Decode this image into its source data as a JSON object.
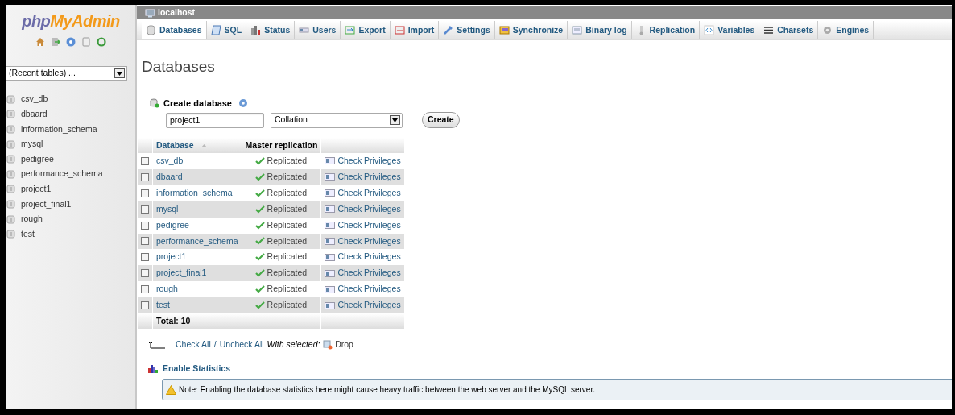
{
  "logo": {
    "part_1": "php",
    "part_2": "MyAdmin"
  },
  "recent_tables": {
    "value": "(Recent tables) ..."
  },
  "sidebar": {
    "items": [
      {
        "label": "csv_db"
      },
      {
        "label": "dbaard"
      },
      {
        "label": "information_schema"
      },
      {
        "label": "mysql"
      },
      {
        "label": "pedigree"
      },
      {
        "label": "performance_schema"
      },
      {
        "label": "project1"
      },
      {
        "label": "project_final1"
      },
      {
        "label": "rough"
      },
      {
        "label": "test"
      }
    ]
  },
  "breadcrumb": "localhost",
  "tabs": [
    {
      "label": "Databases",
      "selected": true
    },
    {
      "label": "SQL",
      "selected": false
    },
    {
      "label": "Status",
      "selected": false
    },
    {
      "label": "Users",
      "selected": false
    },
    {
      "label": "Export",
      "selected": false
    },
    {
      "label": "Import",
      "selected": false
    },
    {
      "label": "Settings",
      "selected": false
    },
    {
      "label": "Synchronize",
      "selected": false
    },
    {
      "label": "Binary log",
      "selected": false
    },
    {
      "label": "Replication",
      "selected": false
    },
    {
      "label": "Variables",
      "selected": false
    },
    {
      "label": "Charsets",
      "selected": false
    },
    {
      "label": "Engines",
      "selected": false
    }
  ],
  "heading": "Databases",
  "create_database": {
    "label": "Create database",
    "name_value": "project1",
    "collation": "Collation",
    "button": "Create"
  },
  "table": {
    "columns": [
      "Database",
      "Master replication"
    ],
    "rows": [
      {
        "name": "csv_db",
        "replication": "Replicated",
        "action": "Check Privileges",
        "checked": false
      },
      {
        "name": "dbaard",
        "replication": "Replicated",
        "action": "Check Privileges",
        "checked": false
      },
      {
        "name": "information_schema",
        "replication": "Replicated",
        "action": "Check Privileges",
        "checked": false
      },
      {
        "name": "mysql",
        "replication": "Replicated",
        "action": "Check Privileges",
        "checked": false
      },
      {
        "name": "pedigree",
        "replication": "Replicated",
        "action": "Check Privileges",
        "checked": false
      },
      {
        "name": "performance_schema",
        "replication": "Replicated",
        "action": "Check Privileges",
        "checked": false
      },
      {
        "name": "project1",
        "replication": "Replicated",
        "action": "Check Privileges",
        "checked": false
      },
      {
        "name": "project_final1",
        "replication": "Replicated",
        "action": "Check Privileges",
        "checked": false
      },
      {
        "name": "rough",
        "replication": "Replicated",
        "action": "Check Privileges",
        "checked": false
      },
      {
        "name": "test",
        "replication": "Replicated",
        "action": "Check Privileges",
        "checked": false
      }
    ],
    "total": "Total: 10"
  },
  "bulk": {
    "check_all": "Check All",
    "separator": "/",
    "uncheck_all": "Uncheck All",
    "with_selected": "With selected:",
    "drop": "Drop"
  },
  "enable_statistics": "Enable Statistics",
  "note": "Note: Enabling the database statistics here might cause heavy traffic between the web server and the MySQL server."
}
